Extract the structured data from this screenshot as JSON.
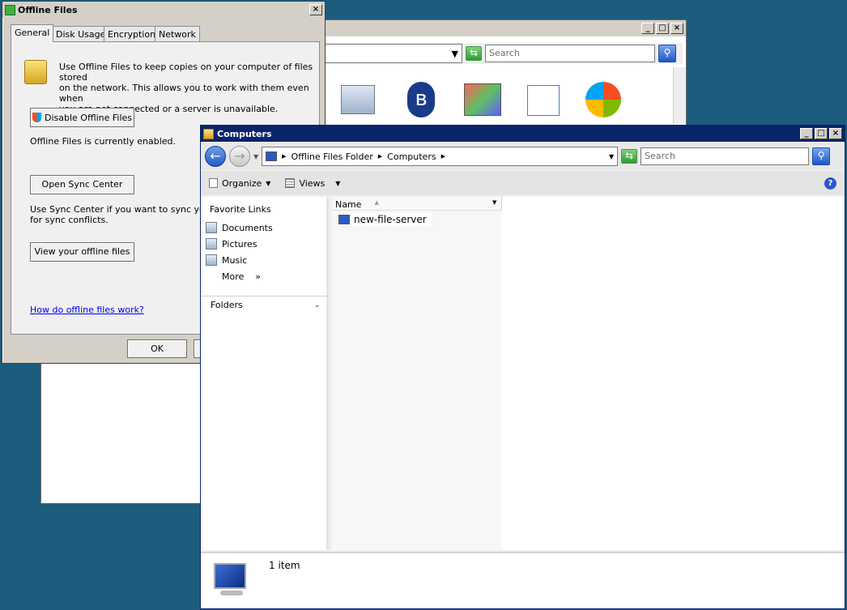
{
  "bg_window": {
    "search_placeholder": "Search"
  },
  "offline_dialog": {
    "title": "Offline Files",
    "tabs": [
      "General",
      "Disk Usage",
      "Encryption",
      "Network"
    ],
    "intro_line1": "Use Offline Files to keep copies on your computer of files stored",
    "intro_line2": "on the network.  This allows you to work with them even when",
    "intro_line3": "you are not connected or a server is unavailable.",
    "disable_button": "Disable Offline Files",
    "status_text": "Offline Files is currently enabled.",
    "sync_button": "Open Sync Center",
    "sync_text_line1": "Use Sync Center if you want to sync your O",
    "sync_text_line2": "for sync conflicts.",
    "view_button": "View your offline files",
    "help_link": "How do offline files work?",
    "ok_button": "OK"
  },
  "explorer": {
    "title": "Computers",
    "breadcrumb": [
      "Offline Files Folder",
      "Computers"
    ],
    "search_placeholder": "Search",
    "toolbar": {
      "organize": "Organize",
      "views": "Views"
    },
    "favorites_header": "Favorite Links",
    "favorites": [
      "Documents",
      "Pictures",
      "Music"
    ],
    "more_label": "More",
    "more_glyph": "»",
    "folders_label": "Folders",
    "column_name": "Name",
    "files": [
      {
        "name": "new-file-server"
      }
    ],
    "status_text": "1 item"
  },
  "colors": {
    "desktop": "#1c5c7d",
    "active_title": "#0a246a"
  }
}
